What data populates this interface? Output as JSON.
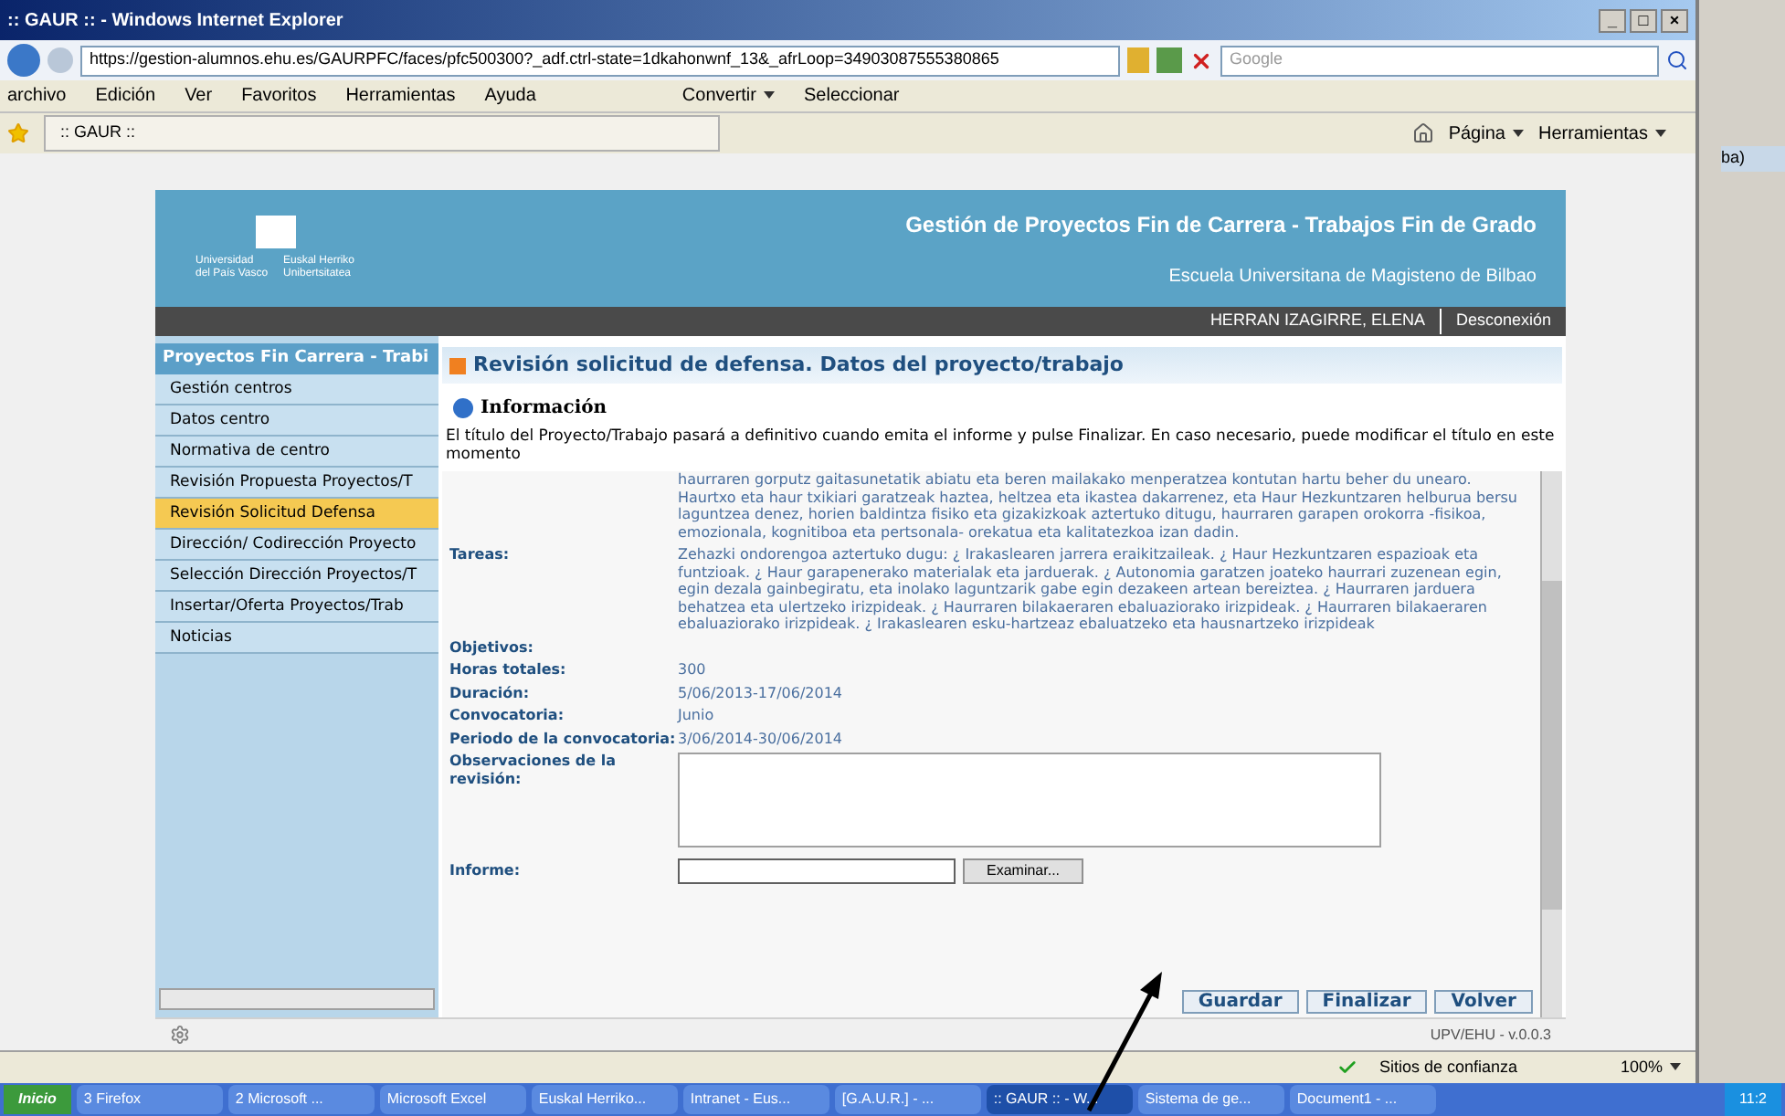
{
  "window": {
    "title": ":: GAUR :: - Windows Internet Explorer",
    "controls": [
      "_",
      "□",
      "×"
    ]
  },
  "address_bar": {
    "url": "https://gestion-alumnos.ehu.es/GAURPFC/faces/pfc500300?_adf.ctrl-state=1dkahonwnf_13&_afrLoop=34903087555380865",
    "search_placeholder": "Google"
  },
  "menu": [
    "archivo",
    "Edición",
    "Ver",
    "Favoritos",
    "Herramientas",
    "Ayuda"
  ],
  "toolbar_buttons": [
    "Convertir",
    "Seleccionar"
  ],
  "tab": {
    "label": ":: GAUR ::"
  },
  "command_bar": [
    "Página",
    "Herramientas"
  ],
  "header": {
    "university": [
      "Universidad del País Vasco",
      "Euskal Herriko Unibertsitatea"
    ],
    "title": "Gestión de Proyectos Fin de Carrera - Trabajos Fin de Grado",
    "school": "Escuela Universitana de Magisteno de Bilbao"
  },
  "user_bar": {
    "user": "HERRAN IZAGIRRE, ELENA",
    "logout": "Desconexión"
  },
  "sidebar": {
    "title": "Proyectos Fin Carrera - Trabi",
    "items": [
      {
        "label": "Gestión centros",
        "selected": false
      },
      {
        "label": "Datos centro",
        "selected": false
      },
      {
        "label": "Normativa de centro",
        "selected": false
      },
      {
        "label": "Revisión Propuesta Proyectos/T",
        "selected": false
      },
      {
        "label": "Revisión Solicitud Defensa",
        "selected": true
      },
      {
        "label": "Dirección/ Codirección Proyecto",
        "selected": false
      },
      {
        "label": "Selección Dirección Proyectos/T",
        "selected": false
      },
      {
        "label": "Insertar/Oferta Proyectos/Trab",
        "selected": false
      },
      {
        "label": "Noticias",
        "selected": false
      }
    ]
  },
  "panel": {
    "title": "Revisión solicitud de defensa. Datos del proyecto/trabajo",
    "info_heading": "Información",
    "info_text": "El título del Proyecto/Trabajo pasará a definitivo cuando emita el informe y pulse Finalizar. En caso necesario, puede modificar el título en este momento"
  },
  "fields": [
    {
      "value": "haurraren gorputz gaitasunetatik abiatu eta beren mailakako menperatzea kontutan hartu beher du unearo. Haurtxo eta haur txikiari garatzeak haztea, heltzea eta ikastea dakarrenez, eta Haur Hezkuntzaren helburua bersu laguntzea denez, horien baldintza fisiko eta gizakizkoak aztertuko ditugu, haurraren garapen orokorra -fisikoa, emozionala, kognitiboa eta pertsonala- orekatua eta kalitatezkoa izan dadin."
    },
    {
      "label": "Tareas:",
      "value": "Zehazki ondorengoa aztertuko dugu: ¿ Irakaslearen jarrera eraikitzaileak. ¿ Haur Hezkuntzaren espazioak eta funtzioak. ¿ Haur garapenerako materialak eta jarduerak. ¿ Autonomia garatzen joateko haurrari zuzenean egin, egin dezala gainbegiratu, eta inolako laguntzarik gabe egin dezakeen artean bereiztea. ¿ Haurraren jarduera behatzea eta ulertzeko irizpideak. ¿ Haurraren bilakaeraren ebaluaziorako irizpideak. ¿ Haurraren bilakaeraren ebaluaziorako irizpideak. ¿ Irakaslearen esku-hartzeaz ebaluatzeko eta hausnartzeko irizpideak"
    },
    {
      "label": "Objetivos:"
    },
    {
      "label": "Horas totales:",
      "value": "300"
    },
    {
      "label": "Duración:",
      "value": "5/06/2013-17/06/2014"
    },
    {
      "label": "Convocatoria:",
      "value": "Junio"
    },
    {
      "label": "Periodo de la convocatoria:",
      "value": "3/06/2014-30/06/2014"
    }
  ],
  "observations": {
    "label": "Observaciones de la revisión:"
  },
  "report": {
    "label": "Informe:",
    "browse": "Examinar..."
  },
  "actions": [
    "Guardar",
    "Finalizar",
    "Volver"
  ],
  "footer": {
    "version": "UPV/EHU - v.0.0.3"
  },
  "status_bar": {
    "zone": "Sitios de confianza",
    "zoom": "100%"
  },
  "taskbar": {
    "start": "Inicio",
    "items": [
      {
        "label": "3 Firefox",
        "selected": false
      },
      {
        "label": "2 Microsoft ...",
        "selected": false
      },
      {
        "label": "Microsoft Excel",
        "selected": false
      },
      {
        "label": "Euskal Herriko...",
        "selected": false
      },
      {
        "label": "Intranet - Eus...",
        "selected": false
      },
      {
        "label": "[G.A.U.R.] - ...",
        "selected": false
      },
      {
        "label": ":: GAUR :: - W...",
        "selected": true
      },
      {
        "label": "Sistema de ge...",
        "selected": false
      },
      {
        "label": "Document1 - ...",
        "selected": false
      }
    ],
    "clock": "11:2"
  },
  "background_window": {
    "text": "ba)"
  }
}
